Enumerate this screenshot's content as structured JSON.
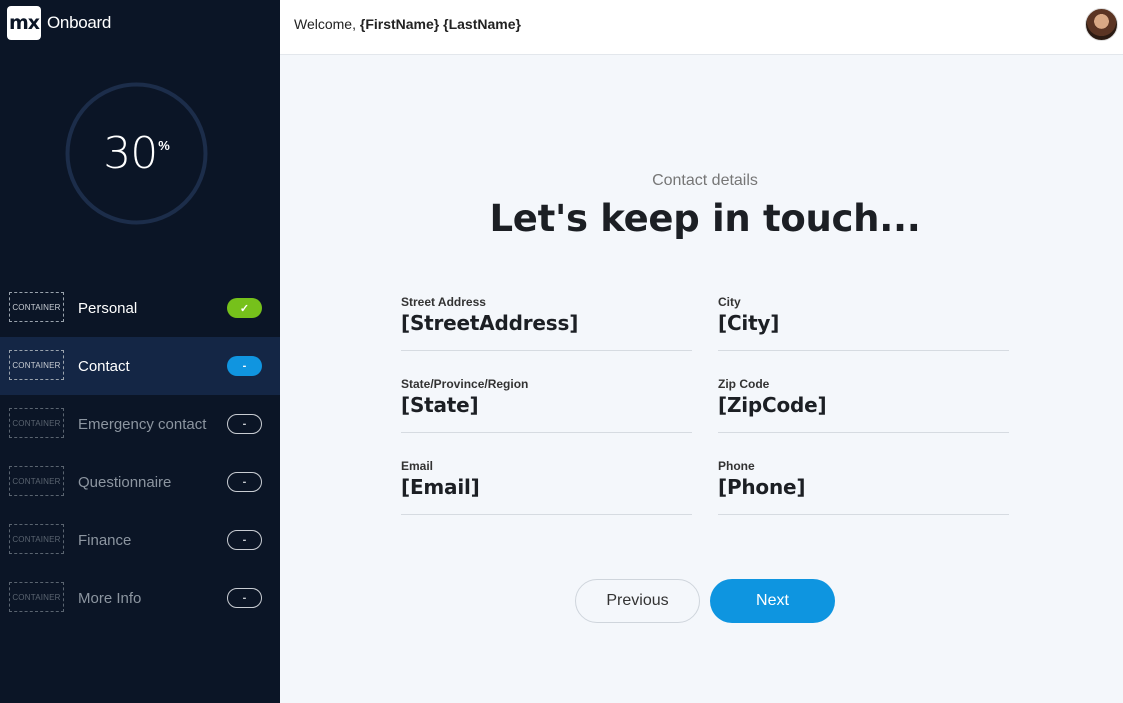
{
  "brand": {
    "logo_text": "mx",
    "name": "Onboard"
  },
  "progress": {
    "value": "30",
    "unit": "%",
    "fraction": 0.3
  },
  "nav": {
    "container_label": "CONTAINER",
    "items": [
      {
        "label": "Personal",
        "status": "done",
        "badge": "✓"
      },
      {
        "label": "Contact",
        "status": "current",
        "badge": "-"
      },
      {
        "label": "Emergency contact",
        "status": "todo",
        "badge": "-"
      },
      {
        "label": "Questionnaire",
        "status": "todo",
        "badge": "-"
      },
      {
        "label": "Finance",
        "status": "todo",
        "badge": "-"
      },
      {
        "label": "More Info",
        "status": "todo",
        "badge": "-"
      }
    ]
  },
  "header": {
    "welcome_prefix": "Welcome,",
    "user_name": "{FirstName} {LastName}"
  },
  "main": {
    "subtitle": "Contact details",
    "title": "Let's keep in touch...",
    "fields": {
      "street": {
        "label": "Street Address",
        "value": "[StreetAddress]"
      },
      "city": {
        "label": "City",
        "value": "[City]"
      },
      "state": {
        "label": "State/Province/Region",
        "value": "[State]"
      },
      "zip": {
        "label": "Zip Code",
        "value": "[ZipCode]"
      },
      "email": {
        "label": "Email",
        "value": "[Email]"
      },
      "phone": {
        "label": "Phone",
        "value": "[Phone]"
      }
    },
    "buttons": {
      "previous": "Previous",
      "next": "Next"
    }
  },
  "colors": {
    "sidebar_bg": "#0b1526",
    "active_item_bg": "#142645",
    "done_green": "#76c11b",
    "accent_blue": "#0e95e0"
  }
}
